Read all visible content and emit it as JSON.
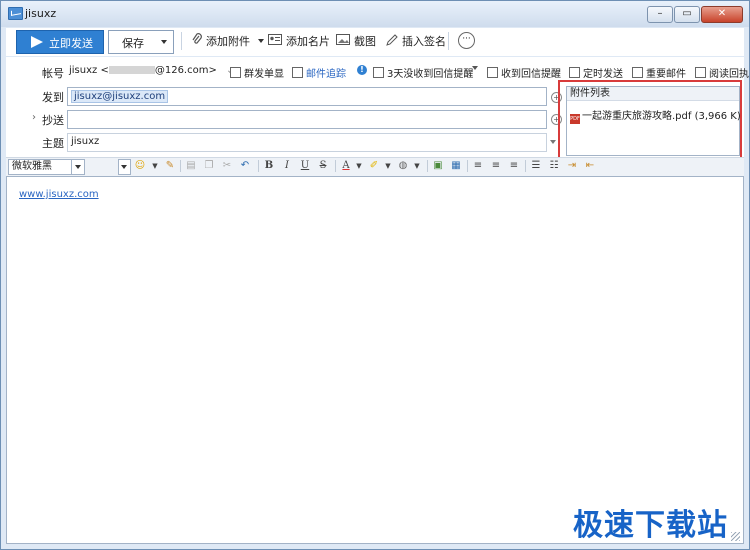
{
  "window": {
    "title": "jisuxz"
  },
  "toolbar": {
    "send_label": "立即发送",
    "save_label": "保存",
    "add_attachment_label": "添加附件",
    "add_card_label": "添加名片",
    "screenshot_label": "截图",
    "insert_signature_label": "插入签名",
    "more_label": "···"
  },
  "form": {
    "account_label": "帐号",
    "account_name": "jisuxz <",
    "account_domain": "@126.com>",
    "group_send_label": "群发单显",
    "mail_tracking_label": "邮件追踪",
    "no_reply_reminder_label": "3天没收到回信提醒",
    "read_receipt_reminder_label": "收到回信提醒",
    "scheduled_send_label": "定时发送",
    "important_label": "重要邮件",
    "read_receipt_label": "阅读回执",
    "to_label": "发到",
    "to_value": "jisuxz@jisuxz.com",
    "cc_label": "抄送",
    "subject_label": "主题",
    "subject_value": "jisuxz"
  },
  "attachments": {
    "header": "附件列表",
    "files": [
      {
        "name": "一起游重庆旅游攻略.pdf (3,966 K)",
        "type": "pdf"
      }
    ]
  },
  "format_bar": {
    "font": "微软雅黑",
    "bold": "B",
    "italic": "I",
    "underline": "U",
    "strike": "S",
    "font_color": "A"
  },
  "body": {
    "text": "www.jisuxz.com"
  },
  "watermark": "极速下载站",
  "colors": {
    "accent": "#2f80d2",
    "highlight_box": "#d83b3b",
    "link": "#2a66c2"
  }
}
